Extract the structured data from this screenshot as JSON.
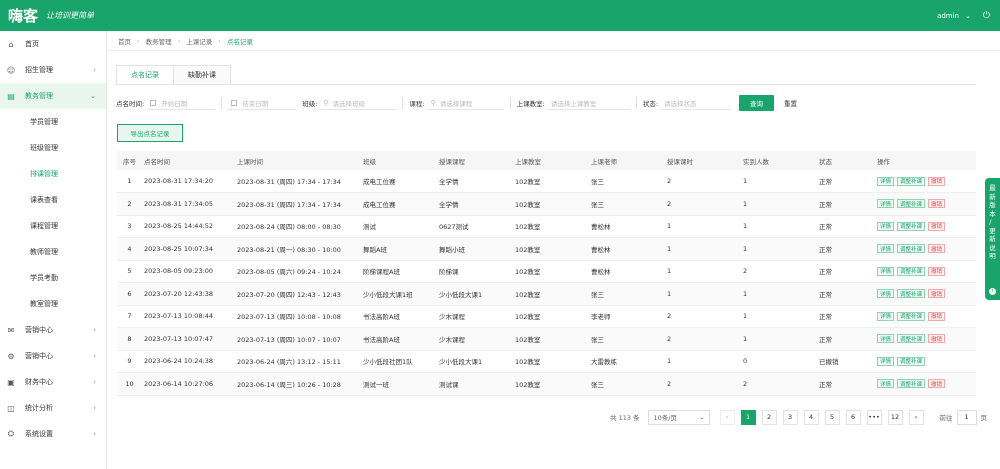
{
  "header": {
    "logo": "嗨客",
    "slogan": "让培训更简单",
    "user": "admin",
    "dropdown_icon": "chevron-down-icon",
    "power_icon": "power-icon"
  },
  "sidebar": {
    "items": [
      {
        "label": "首页",
        "icon": "home-icon"
      },
      {
        "label": "招生管理",
        "icon": "user-plus-icon"
      },
      {
        "label": "教务管理",
        "icon": "book-icon"
      }
    ],
    "sub_items": [
      "学员管理",
      "班级管理",
      "排课管理",
      "课表查看",
      "课程管理",
      "教师管理",
      "学员考勤",
      "教室管理"
    ],
    "bottom_items": [
      {
        "label": "营销中心",
        "icon": "megaphone-icon"
      },
      {
        "label": "营销中心",
        "icon": "gear-icon"
      },
      {
        "label": "财务中心",
        "icon": "wallet-icon"
      },
      {
        "label": "统计分析",
        "icon": "chart-icon"
      },
      {
        "label": "系统设置",
        "icon": "settings-icon"
      }
    ]
  },
  "breadcrumb": [
    "首页",
    "教务管理",
    "上课记录",
    "点名记录"
  ],
  "tabs": [
    "点名记录",
    "缺勤补课"
  ],
  "filters": {
    "time_label": "点名时间:",
    "start_placeholder": "开始日期",
    "end_placeholder": "结束日期",
    "class_label": "班级:",
    "class_placeholder": "请选择班级",
    "course_label": "课程:",
    "course_placeholder": "请选择课程",
    "room_label": "上课教室:",
    "room_placeholder": "请选择上课教室",
    "status_label": "状态:",
    "status_placeholder": "请选择状态",
    "query_label": "查询",
    "reset_label": "重置"
  },
  "export_label": "导出点名记录",
  "table": {
    "headers": [
      "序号",
      "点名时间",
      "上课时间",
      "班级",
      "授课课程",
      "上课教室",
      "上课老师",
      "授课课时",
      "实到人数",
      "状态",
      "操作"
    ],
    "rows": [
      [
        "1",
        "2023-08-31 17:34:20",
        "2023-08-31 (周四) 17:34 - 17:34",
        "成电工位赛",
        "全学情",
        "102教室",
        "张三",
        "2",
        "1",
        "正常"
      ],
      [
        "2",
        "2023-08-31 17:34:05",
        "2023-08-31 (周四) 17:34 - 17:34",
        "成电工位赛",
        "全学情",
        "102教室",
        "张三",
        "2",
        "1",
        "正常"
      ],
      [
        "3",
        "2023-08-25 14:44:52",
        "2023-08-24 (周四) 08:00 - 08:30",
        "测试",
        "0627测试",
        "102教室",
        "曹松林",
        "1",
        "1",
        "正常"
      ],
      [
        "4",
        "2023-08-25 10:07:34",
        "2023-08-21 (周一) 08:30 - 10:00",
        "舞蹈A班",
        "舞蹈小班",
        "102教室",
        "曹松林",
        "1",
        "1",
        "正常"
      ],
      [
        "5",
        "2023-08-05 09:23:00",
        "2023-08-05 (周六) 09:24 - 10:24",
        "阶梯课程A班",
        "阶梯课",
        "102教室",
        "曹松林",
        "1",
        "2",
        "正常"
      ],
      [
        "6",
        "2023-07-20 12:43:38",
        "2023-07-20 (周四) 12:43 - 12:43",
        "少小低段大课1班",
        "少小低段大课1",
        "102教室",
        "张三",
        "1",
        "1",
        "正常"
      ],
      [
        "7",
        "2023-07-13 10:08:44",
        "2023-07-13 (周四) 10:08 - 10:08",
        "书法高阶A班",
        "少木课程",
        "102教室",
        "李老师",
        "2",
        "1",
        "正常"
      ],
      [
        "8",
        "2023-07-13 10:07:47",
        "2023-07-13 (周四) 10:07 - 10:07",
        "书法高阶A班",
        "少木课程",
        "102教室",
        "张三",
        "2",
        "1",
        "正常"
      ],
      [
        "9",
        "2023-06-24 10:24:38",
        "2023-06-24 (周六) 13:12 - 15:11",
        "少小低段社团1队",
        "少小低段大课1",
        "102教室",
        "大雷教练",
        "1",
        "0",
        "已撤销"
      ],
      [
        "10",
        "2023-06-14 10:27:06",
        "2023-06-14 (周三) 10:26 - 10:28",
        "测试一班",
        "测试课",
        "102教室",
        "张三",
        "2",
        "2",
        "正常"
      ]
    ],
    "ops": {
      "detail": "详情",
      "edit": "调整补课",
      "revoke": "撤销"
    }
  },
  "pagination": {
    "total": "共 113 条",
    "page_size": "10条/页",
    "pages": [
      "1",
      "2",
      "3",
      "4",
      "5",
      "6",
      "•••",
      "12"
    ],
    "prev_icon": "chevron-left-icon",
    "next_icon": "chevron-right-icon",
    "goto_label": "前往",
    "goto_value": "1",
    "goto_suffix": "页"
  },
  "float_widget": {
    "text": "最新版本 / 更新说明",
    "icon": "info-icon"
  },
  "colors": {
    "brand": "#18a46b",
    "danger": "#e14a4a"
  }
}
